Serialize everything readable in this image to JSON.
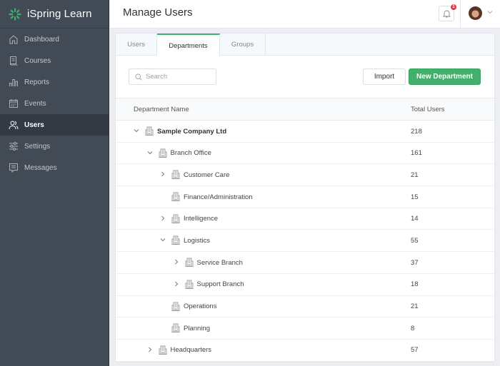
{
  "app": {
    "name": "iSpring Learn",
    "brand_color": "#3bb36a"
  },
  "sidebar": {
    "items": [
      {
        "label": "Dashboard",
        "icon": "home-icon",
        "active": false
      },
      {
        "label": "Courses",
        "icon": "courses-icon",
        "active": false
      },
      {
        "label": "Reports",
        "icon": "bar-chart-icon",
        "active": false
      },
      {
        "label": "Events",
        "icon": "calendar-icon",
        "active": false
      },
      {
        "label": "Users",
        "icon": "users-icon",
        "active": true
      },
      {
        "label": "Settings",
        "icon": "sliders-icon",
        "active": false
      },
      {
        "label": "Messages",
        "icon": "message-icon",
        "active": false
      }
    ]
  },
  "header": {
    "title": "Manage Users",
    "notification_count": "1"
  },
  "tabs": [
    {
      "label": "Users",
      "active": false
    },
    {
      "label": "Departments",
      "active": true
    },
    {
      "label": "Groups",
      "active": false
    }
  ],
  "toolbar": {
    "search_placeholder": "Search",
    "search_value": "",
    "import_label": "Import",
    "new_department_label": "New Department"
  },
  "table": {
    "columns": [
      "Department Name",
      "Total Users"
    ],
    "rows": [
      {
        "name": "Sample Company Ltd",
        "total": "218",
        "level": 0,
        "toggle": "expanded",
        "bold": true
      },
      {
        "name": "Branch Office",
        "total": "161",
        "level": 1,
        "toggle": "expanded",
        "bold": false
      },
      {
        "name": "Customer Care",
        "total": "21",
        "level": 2,
        "toggle": "collapsed",
        "bold": false
      },
      {
        "name": "Finance/Administration",
        "total": "15",
        "level": 2,
        "toggle": "none",
        "bold": false
      },
      {
        "name": "Intelligence",
        "total": "14",
        "level": 2,
        "toggle": "collapsed",
        "bold": false
      },
      {
        "name": "Logistics",
        "total": "55",
        "level": 2,
        "toggle": "expanded",
        "bold": false
      },
      {
        "name": "Service Branch",
        "total": "37",
        "level": 3,
        "toggle": "collapsed",
        "bold": false
      },
      {
        "name": "Support Branch",
        "total": "18",
        "level": 3,
        "toggle": "collapsed",
        "bold": false
      },
      {
        "name": "Operations",
        "total": "21",
        "level": 2,
        "toggle": "none",
        "bold": false
      },
      {
        "name": "Planning",
        "total": "8",
        "level": 2,
        "toggle": "none",
        "bold": false
      },
      {
        "name": "Headquarters",
        "total": "57",
        "level": 1,
        "toggle": "collapsed",
        "bold": false
      }
    ]
  }
}
